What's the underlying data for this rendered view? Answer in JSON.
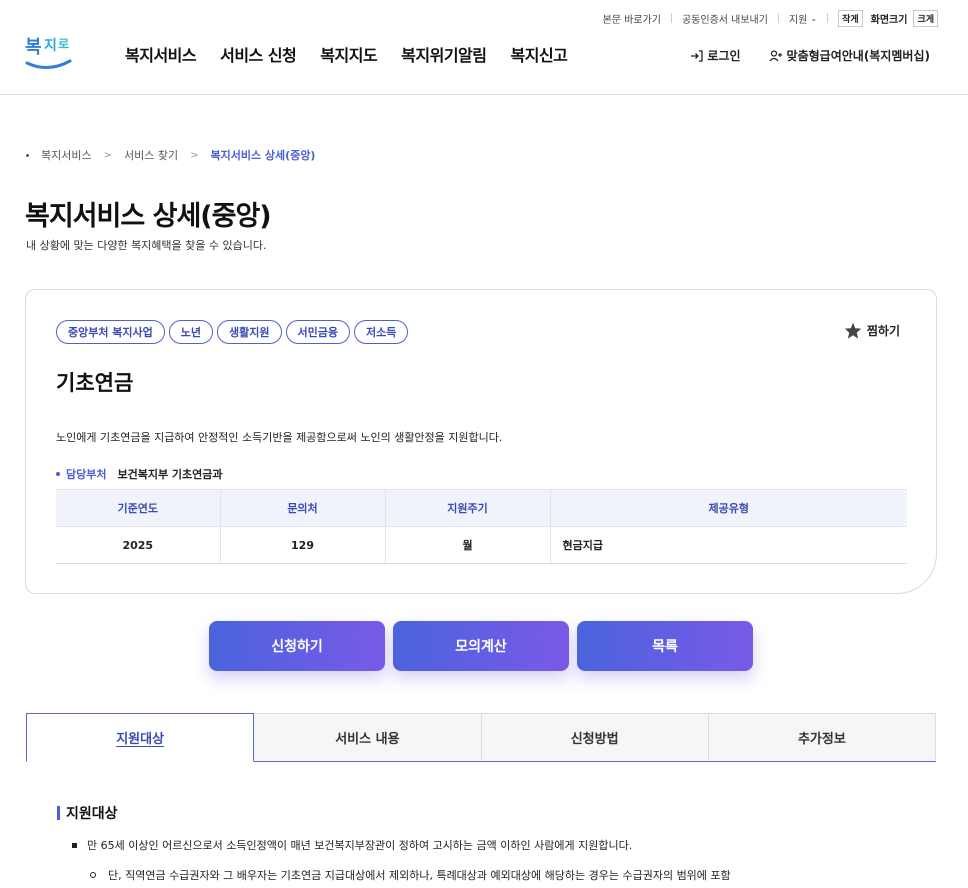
{
  "utility": {
    "skip_link": "본문 바로가기",
    "cert_export": "공동인증서 내보내기",
    "region": "지원",
    "font_small": "작게",
    "font_label": "화면크기",
    "font_large": "크게"
  },
  "header": {
    "logo_text": "복지로",
    "nav": [
      "복지서비스",
      "서비스 신청",
      "복지지도",
      "복지위기알림",
      "복지신고"
    ],
    "login": "로그인",
    "membership": "맞춤형급여안내(복지멤버십)"
  },
  "breadcrumb": [
    "복지서비스",
    "서비스 찾기",
    "복지서비스 상세(중앙)"
  ],
  "page": {
    "title": "복지서비스 상세(중앙)",
    "subtitle": "내 상황에 맞는 다양한 복지혜택을 찾을 수 있습니다."
  },
  "service": {
    "tags": [
      "중앙부처 복지사업",
      "노년",
      "생활지원",
      "서민금융",
      "저소득"
    ],
    "favorite_label": "찜하기",
    "name": "기초연금",
    "description": "노인에게 기초연금을 지급하여 안정적인 소득기반을 제공함으로써 노인의 생활안정을 지원합니다.",
    "dept_label": "담당부처",
    "dept_value": "보건복지부 기초연금과",
    "table": {
      "headers": [
        "기준연도",
        "문의처",
        "지원주기",
        "제공유형"
      ],
      "row": [
        "2025",
        "129",
        "월",
        "현금지급"
      ]
    }
  },
  "actions": {
    "apply": "신청하기",
    "simulate": "모의계산",
    "list": "목록"
  },
  "tabs": [
    "지원대상",
    "서비스 내용",
    "신청방법",
    "추가정보"
  ],
  "content": {
    "section_title": "지원대상",
    "item1": "만 65세 이상인 어르신으로서 소득인정액이 매년 보건복지부장관이 정하여 고시하는 금액 이하인 사람에게 지원합니다.",
    "item1_sub": "단, 직역연금 수급권자와 그 배우자는 기초연금 지급대상에서 제외하나, 특례대상과 예외대상에 해당하는 경우는 수급권자의 범위에 포함"
  },
  "colors": {
    "accent": "#4a5fd6",
    "button_gradient_start": "#4a63dc",
    "button_gradient_end": "#7a5ae8"
  }
}
